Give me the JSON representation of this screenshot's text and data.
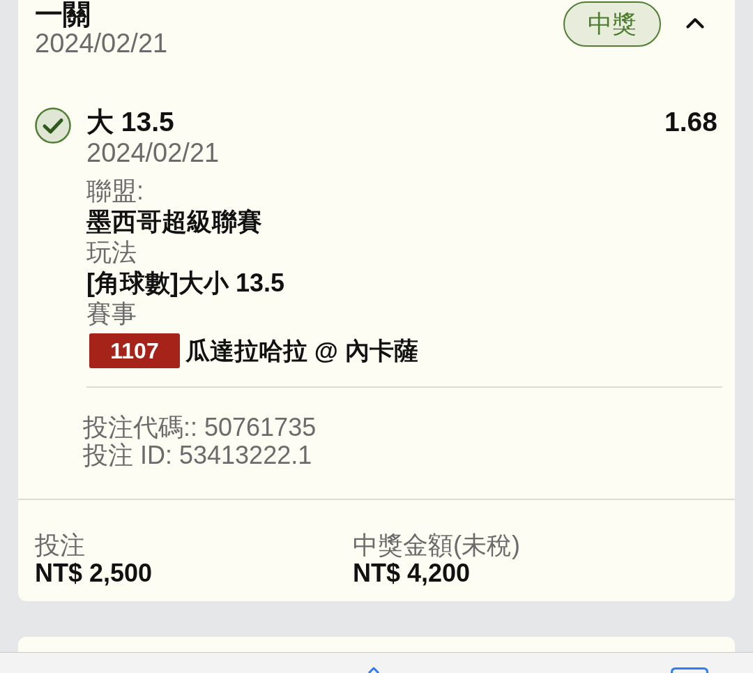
{
  "parlay": {
    "title": "一關",
    "date": "2024/02/21",
    "status": {
      "label": "中獎",
      "kind": "won"
    },
    "expanded": true
  },
  "selections": [
    {
      "kind": "won",
      "pick": "大 13.5",
      "date": "2024/02/21",
      "odds": "1.68",
      "fields": [
        {
          "label": "聯盟:",
          "value": "墨西哥超級聯賽"
        },
        {
          "label": "玩法",
          "value": "[角球數]大小 13.5"
        },
        {
          "label": "賽事",
          "match_code": "1107",
          "value": "瓜達拉哈拉 @ 內卡薩"
        }
      ]
    }
  ],
  "references": [
    "投注代碼:: 50761735",
    "投注 ID: 53413222.1"
  ],
  "summary": [
    {
      "label": "投注",
      "value": "NT$ 2,500"
    },
    {
      "label": "中獎金額(未稅)",
      "value": "NT$ 4,200"
    }
  ]
}
